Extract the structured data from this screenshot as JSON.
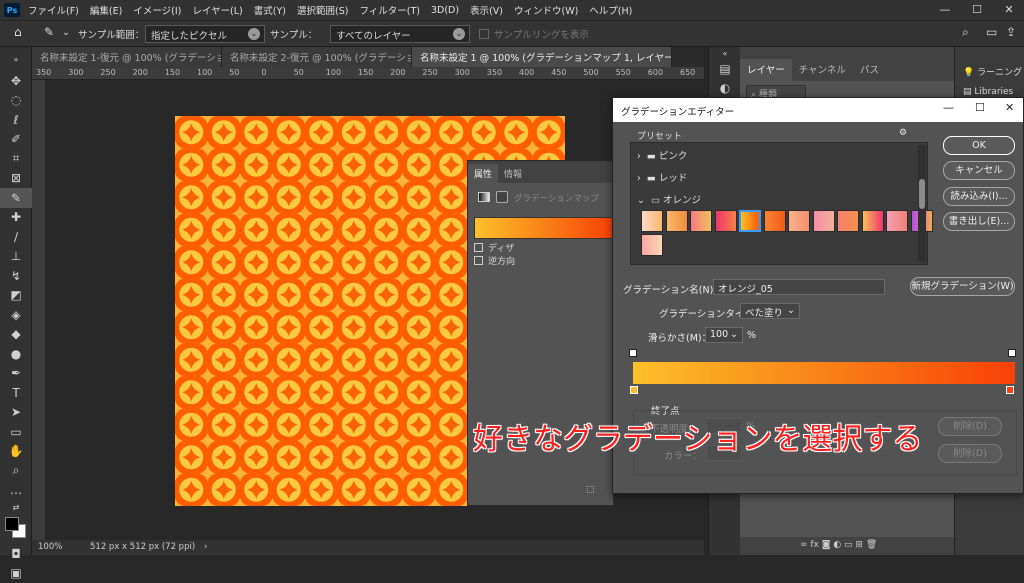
{
  "app": {
    "logo": "Ps"
  },
  "menu": [
    "ファイル(F)",
    "編集(E)",
    "イメージ(I)",
    "レイヤー(L)",
    "書式(Y)",
    "選択範囲(S)",
    "フィルター(T)",
    "3D(D)",
    "表示(V)",
    "ウィンドウ(W)",
    "ヘルプ(H)"
  ],
  "options": {
    "sample_range_label": "サンプル範囲：",
    "sample_range_value": "指定したピクセル",
    "sample_label": "サンプル：",
    "sample_value": "すべてのレイヤー",
    "sample_ring_label": "サンプルリングを表示"
  },
  "tabs": [
    {
      "label": "名称未設定 1-復元 @ 100% (グラデーショ...",
      "active": false
    },
    {
      "label": "名称未設定 2-復元 @ 100% (グラデーショ...",
      "active": false
    },
    {
      "label": "名称未設定 1 @ 100% (グラデーションマップ 1, レイヤーマスク/8) *",
      "active": true
    }
  ],
  "ruler": [
    "350",
    "300",
    "250",
    "200",
    "150",
    "100",
    "50",
    "0",
    "50",
    "100",
    "150",
    "200",
    "250",
    "300",
    "350",
    "400",
    "450",
    "500",
    "550",
    "600",
    "650"
  ],
  "status": {
    "zoom": "100%",
    "doc_info": "512 px x 512 px (72 ppi)",
    "arrow": "›"
  },
  "properties": {
    "tabs": [
      "属性",
      "情報"
    ],
    "title": "グラデーションマップ",
    "dither_label": "ディザ",
    "reverse_label": "逆方向"
  },
  "layers": {
    "tabs": [
      "レイヤー",
      "チャンネル",
      "パス"
    ],
    "search_placeholder": "種類"
  },
  "far_right": {
    "learn_label": "ラーニング",
    "libraries_label": "Libraries"
  },
  "dialog": {
    "title": "グラデーションエディター",
    "presets_label": "プリセット",
    "folders": [
      "ピンク",
      "レッド",
      "オレンジ"
    ],
    "swatches": [
      [
        "#fdd9c5",
        "#fcb86c"
      ],
      [
        "#f7b96b",
        "#f08d3b"
      ],
      [
        "#f67b83",
        "#f1c15b"
      ],
      [
        "#f0356b",
        "#f87f48"
      ],
      [
        "#fdc122",
        "#f95a06"
      ],
      [
        "#f88536",
        "#f35a16"
      ],
      [
        "#f7b28a",
        "#f68f6c"
      ],
      [
        "#f58da9",
        "#f3b099"
      ],
      [
        "#f7806c",
        "#f59050"
      ],
      [
        "#fcc05a",
        "#f0336e"
      ],
      [
        "#f59fb3",
        "#f4807b"
      ],
      [
        "#b34de6",
        "#f5a94d"
      ],
      [
        "#f9a5a0",
        "#fcd8b8"
      ]
    ],
    "ok": "OK",
    "cancel": "キャンセル",
    "load": "読み込み(I)...",
    "save": "書き出し(E)...",
    "name_label": "グラデーション名(N)：",
    "name_value": "オレンジ_05",
    "new_gradient": "新規グラデーション(W)",
    "type_label": "グラデーションタイプ：",
    "type_value": "べた塗り",
    "smooth_label": "滑らかさ(M)：",
    "smooth_value": "100",
    "smooth_unit": "%",
    "stops_label": "終了点",
    "opacity_label": "不透明度：",
    "opacity_unit": "%",
    "color_label": "カラー：",
    "delete1": "削除(D)",
    "delete2": "削除(D)",
    "gradient": {
      "start": "#fcc02a",
      "end": "#f94008"
    }
  },
  "overlay_text": "好きなグラデーションを選択する"
}
